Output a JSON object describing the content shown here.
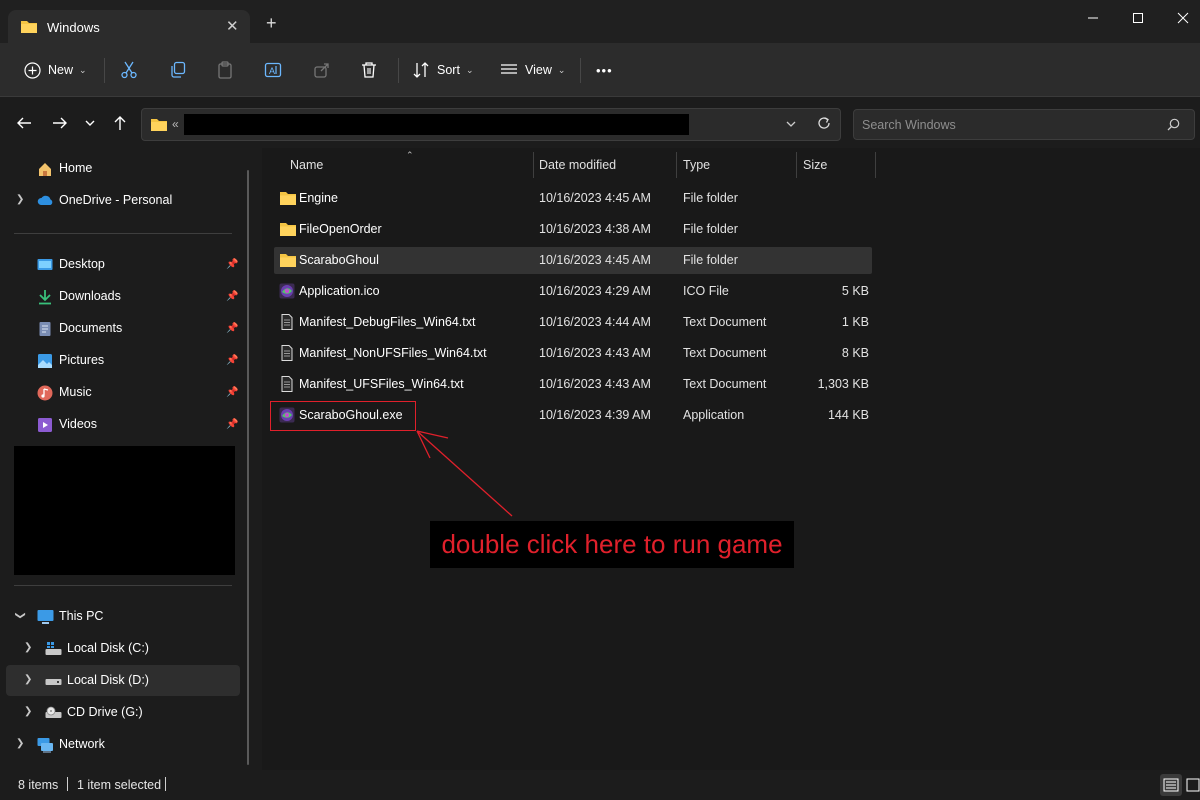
{
  "window": {
    "tab_title": "Windows",
    "tab_close": "✕",
    "new_tab": "+"
  },
  "toolbar": {
    "new_label": "New",
    "sort_label": "Sort",
    "view_label": "View",
    "more_label": "•••"
  },
  "address": {
    "separator": "«"
  },
  "search": {
    "placeholder": "Search Windows"
  },
  "sidebar": {
    "home": "Home",
    "onedrive": "OneDrive - Personal",
    "quick_access": [
      {
        "label": "Desktop"
      },
      {
        "label": "Downloads"
      },
      {
        "label": "Documents"
      },
      {
        "label": "Pictures"
      },
      {
        "label": "Music"
      },
      {
        "label": "Videos"
      }
    ],
    "this_pc": "This PC",
    "drives": [
      {
        "label": "Local Disk (C:)"
      },
      {
        "label": "Local Disk (D:)"
      },
      {
        "label": "CD Drive (G:)"
      }
    ],
    "network": "Network"
  },
  "columns": {
    "name": "Name",
    "date": "Date modified",
    "type": "Type",
    "size": "Size"
  },
  "files": [
    {
      "name": "Engine",
      "date": "10/16/2023 4:45 AM",
      "type": "File folder",
      "size": "",
      "icon": "folder-icon"
    },
    {
      "name": "FileOpenOrder",
      "date": "10/16/2023 4:38 AM",
      "type": "File folder",
      "size": "",
      "icon": "folder-icon"
    },
    {
      "name": "ScaraboGhoul",
      "date": "10/16/2023 4:45 AM",
      "type": "File folder",
      "size": "",
      "icon": "folder-icon"
    },
    {
      "name": "Application.ico",
      "date": "10/16/2023 4:29 AM",
      "type": "ICO File",
      "size": "5 KB",
      "icon": "app-icon"
    },
    {
      "name": "Manifest_DebugFiles_Win64.txt",
      "date": "10/16/2023 4:44 AM",
      "type": "Text Document",
      "size": "1 KB",
      "icon": "text-file-icon"
    },
    {
      "name": "Manifest_NonUFSFiles_Win64.txt",
      "date": "10/16/2023 4:43 AM",
      "type": "Text Document",
      "size": "8 KB",
      "icon": "text-file-icon"
    },
    {
      "name": "Manifest_UFSFiles_Win64.txt",
      "date": "10/16/2023 4:43 AM",
      "type": "Text Document",
      "size": "1,303 KB",
      "icon": "text-file-icon"
    },
    {
      "name": "ScaraboGhoul.exe",
      "date": "10/16/2023 4:39 AM",
      "type": "Application",
      "size": "144 KB",
      "icon": "app-icon"
    }
  ],
  "annotation": {
    "text": "double click here to run game",
    "color": "#e0202b"
  },
  "status": {
    "item_count": "8 items",
    "selection": "1 item selected"
  },
  "colors": {
    "folder": "#f4c443",
    "accent": "#4cc2ff"
  }
}
